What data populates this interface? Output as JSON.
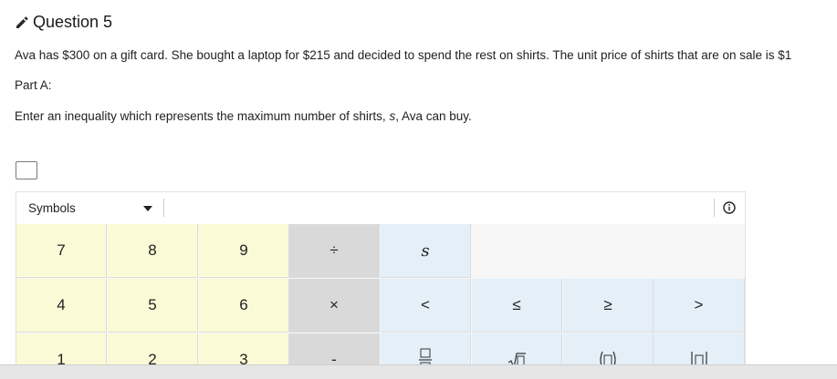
{
  "question": {
    "title": "Question 5",
    "text": "Ava has $300 on a gift card. She bought a laptop for $215 and decided to spend the rest on shirts. The unit price of shirts that are on sale is $1",
    "part_label": "Part A:",
    "prompt_prefix": "Enter an inequality which represents the maximum number of shirts, ",
    "prompt_var": "s",
    "prompt_suffix": ", Ava can buy.",
    "answer_value": ""
  },
  "keypad": {
    "dropdown_label": "Symbols",
    "row1": [
      "7",
      "8",
      "9",
      "÷",
      "s"
    ],
    "row2": [
      "4",
      "5",
      "6",
      "×",
      "<",
      "≤",
      "≥",
      ">"
    ],
    "row3": [
      "1",
      "2",
      "3",
      "-"
    ]
  },
  "colors": {
    "number_key": "#fafbd6",
    "operator_key": "#d9d9d9",
    "symbol_key": "#e4eff8"
  },
  "icons": {
    "header": "pencil-icon",
    "info": "info-icon",
    "templates": [
      "fraction-template-icon",
      "square-root-template-icon",
      "parentheses-template-icon",
      "absolute-value-template-icon"
    ]
  }
}
